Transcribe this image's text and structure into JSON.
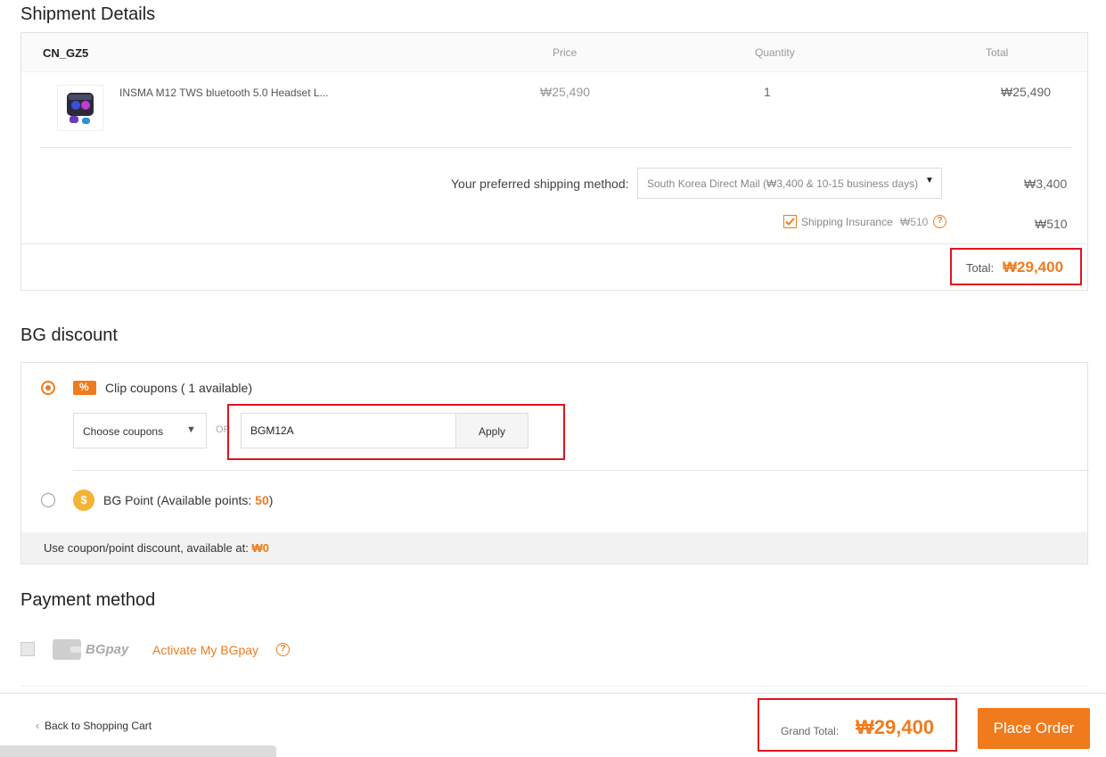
{
  "shipment": {
    "title": "Shipment Details",
    "warehouse": "CN_GZ5",
    "col_price": "Price",
    "col_quantity": "Quantity",
    "col_total": "Total",
    "item": {
      "name": "INSMA M12 TWS bluetooth 5.0 Headset L...",
      "price": "₩25,490",
      "quantity": "1",
      "total": "₩25,490"
    },
    "shipping_label": "Your preferred shipping method:",
    "shipping_option": "South Korea Direct Mail (₩3,400 & 10-15 business days)",
    "shipping_cost": "₩3,400",
    "insurance_label": "Shipping Insurance",
    "insurance_price": "₩510",
    "insurance_cost": "₩510",
    "insurance_checked": true,
    "total_label": "Total:",
    "total_value": "₩29,400"
  },
  "discount": {
    "title": "BG discount",
    "clip_label": "Clip coupons ( 1 available)",
    "choose_coupons": "Choose coupons",
    "or": "OR",
    "coupon_code": "BGM12A",
    "apply": "Apply",
    "bg_point_label": "BG Point (Available points: ",
    "bg_point_value": "50",
    "bg_point_close": ")",
    "usage_label": "Use coupon/point discount, available at: ",
    "usage_value": "₩0"
  },
  "payment": {
    "title": "Payment method",
    "bgpay": "BGpay",
    "activate": "Activate My BGpay"
  },
  "footer": {
    "back": "Back to Shopping Cart",
    "grand_total_label": "Grand Total:",
    "grand_total_value": "₩29,400",
    "place_order": "Place Order"
  },
  "colors": {
    "accent": "#f07b1d",
    "highlight": "#e0141e"
  }
}
